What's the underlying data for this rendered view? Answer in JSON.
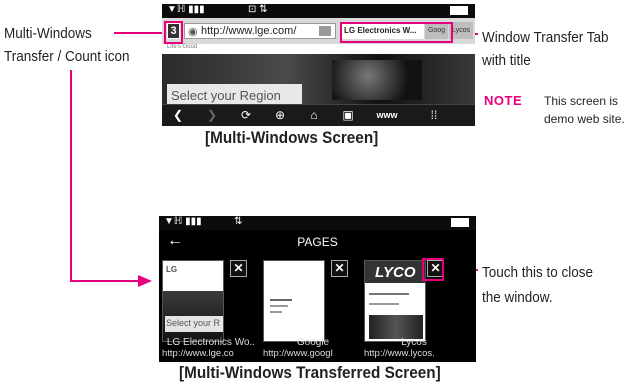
{
  "left_labels": {
    "multi_windows_line1": "Multi-Windows",
    "multi_windows_line2": "Transfer / Count icon"
  },
  "right_labels": {
    "window_tab_line1": "Window Transfer Tab",
    "window_tab_line2": "with title",
    "note_tag": "NOTE",
    "note_line1": "This screen is",
    "note_line2": "demo web site.",
    "close_line1": "Touch this to close",
    "close_line2": "the window."
  },
  "screen1": {
    "url": "http://www.lge.com/",
    "window_count": "3",
    "tabs": [
      "LG Electronics W...",
      "Goog",
      "Lycos"
    ],
    "site_subtitle": "Life's Good",
    "banner_text": "Select your Region",
    "toolbar_www": "www",
    "caption": "[Multi-Windows Screen]"
  },
  "screen2": {
    "title": "PAGES",
    "windows": [
      {
        "title": "LG Electronics Wo..",
        "url": "http://www.lge.co",
        "thumb_text": "Select your R",
        "thumb_logo": "LG"
      },
      {
        "title": "Google",
        "url": "http://www.googl"
      },
      {
        "title": "Lycos",
        "url": "http://www.lycos.",
        "thumb_logo": "LYCO"
      }
    ],
    "close_glyph": "✕",
    "caption": "[Multi-Windows Transferred Screen]"
  },
  "colors": {
    "accent": "#e6007e",
    "screen_bg": "#000000"
  }
}
